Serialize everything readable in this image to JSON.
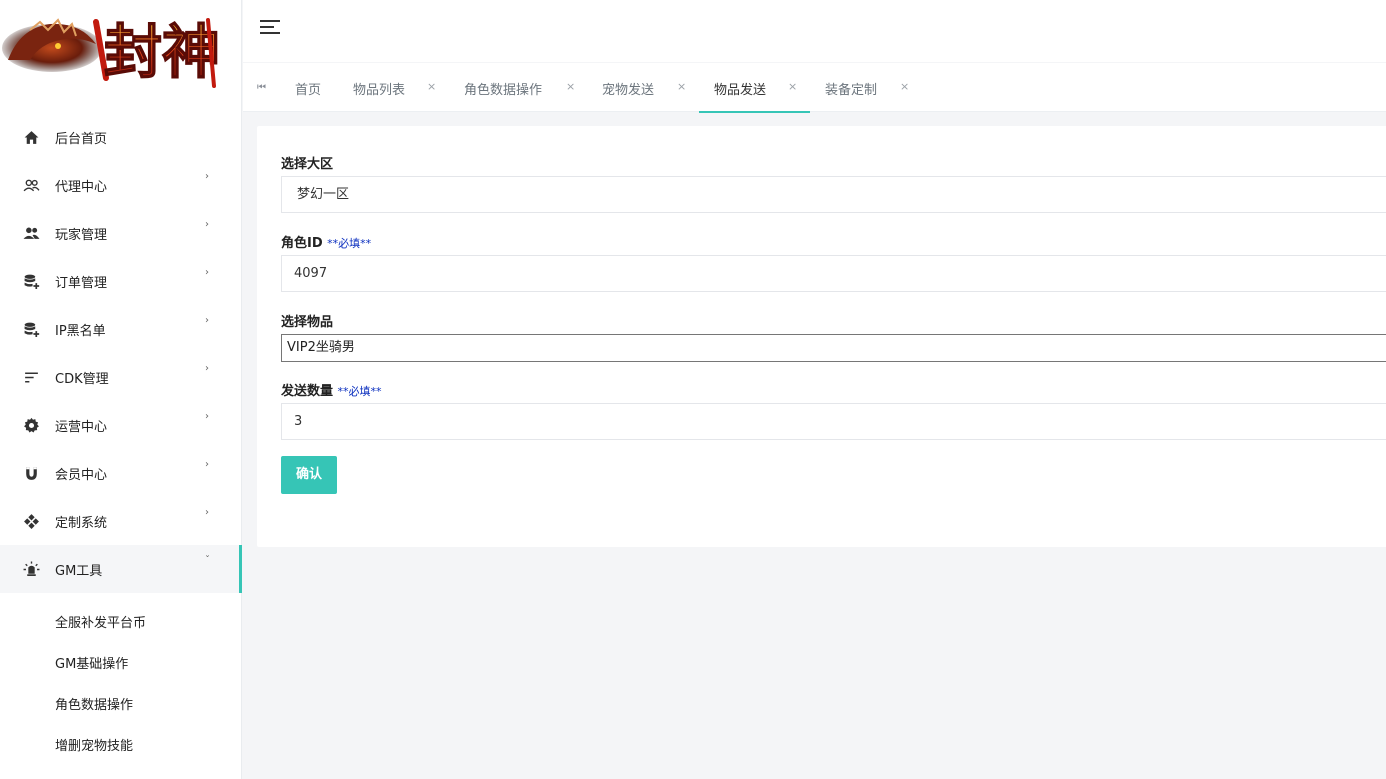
{
  "logo": {
    "text": "封神",
    "icon": "dragon-logo"
  },
  "sidebar": {
    "items": [
      {
        "label": "后台首页",
        "icon": "home-icon",
        "has_children": false
      },
      {
        "label": "代理中心",
        "icon": "users-outline-icon",
        "has_children": true
      },
      {
        "label": "玩家管理",
        "icon": "people-icon",
        "has_children": true
      },
      {
        "label": "订单管理",
        "icon": "database-plus-icon",
        "has_children": true
      },
      {
        "label": "IP黑名单",
        "icon": "database-plus-icon",
        "has_children": true
      },
      {
        "label": "CDK管理",
        "icon": "sort-lines-icon",
        "has_children": true
      },
      {
        "label": "运营中心",
        "icon": "gear-icon",
        "has_children": true
      },
      {
        "label": "会员中心",
        "icon": "magnet-icon",
        "has_children": true
      },
      {
        "label": "定制系统",
        "icon": "diamond-dots-icon",
        "has_children": true
      },
      {
        "label": "GM工具",
        "icon": "lamp-icon",
        "has_children": true,
        "expanded": true
      }
    ],
    "sub_items": [
      "全服补发平台币",
      "GM基础操作",
      "角色数据操作",
      "增删宠物技能"
    ]
  },
  "tabs": [
    {
      "label": "首页",
      "closable": false
    },
    {
      "label": "物品列表",
      "closable": true
    },
    {
      "label": "角色数据操作",
      "closable": true
    },
    {
      "label": "宠物发送",
      "closable": true
    },
    {
      "label": "物品发送",
      "closable": true,
      "active": true
    },
    {
      "label": "装备定制",
      "closable": true
    }
  ],
  "tab_close_glyph": "×",
  "form": {
    "zone_label": "选择大区",
    "zone_value": "梦幻一区",
    "role_label": "角色ID",
    "role_required": "**必填**",
    "role_value": "4097",
    "item_label": "选择物品",
    "item_value": "VIP2坐骑男",
    "qty_label": "发送数量",
    "qty_required": "**必填**",
    "qty_value": "3",
    "submit_label": "确认"
  },
  "colors": {
    "accent": "#36c5b6",
    "required": "#0b2fbf",
    "background": "#f4f5f7"
  }
}
